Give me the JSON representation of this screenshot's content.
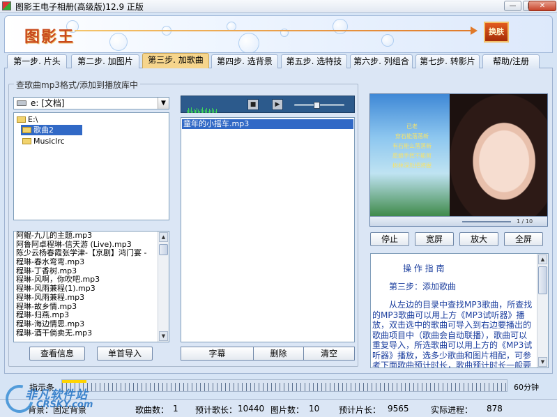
{
  "window": {
    "title": "图影王电子相册(高级版)12.9 正版",
    "minimize": "—",
    "maximize": "□",
    "close": "✕"
  },
  "banner": {
    "logo": "图影王",
    "skin_button": "换肤"
  },
  "tabs": [
    {
      "label": "第一步. 片头"
    },
    {
      "label": "第二步. 加图片"
    },
    {
      "label": "第三步. 加歌曲",
      "active": true
    },
    {
      "label": "第四步. 选背景"
    },
    {
      "label": "第五步. 选特技"
    },
    {
      "label": "第六步. 列组合"
    },
    {
      "label": "第七步. 转影片"
    },
    {
      "label": "帮助/注册"
    }
  ],
  "music_group": {
    "legend": "查歌曲mp3格式/添加到播放库中",
    "drive": "e: [文档]",
    "dirs": [
      {
        "name": "E:\\",
        "selected": false
      },
      {
        "name": "歌曲2",
        "selected": true
      },
      {
        "name": "Musiclrc",
        "selected": false
      }
    ],
    "files": [
      "阿鲲-九儿的主题.mp3",
      "阿鲁阿卓程琳-信天游 (Live).mp3",
      "陈少云杨春霞张学津-【京剧】鸿门宴 -",
      "程琳-春水弯弯.mp3",
      "程琳-丁香树.mp3",
      "程琳-风啊，你吹吧.mp3",
      "程琳-风雨兼程(1).mp3",
      "程琳-风雨兼程.mp3",
      "程琳-故乡情.mp3",
      "程琳-归燕.mp3",
      "程琳-海边情思.mp3",
      "程琳-酒干倘卖无.mp3"
    ],
    "view_info_button": "查看信息",
    "import_button": "单首导入"
  },
  "player": {
    "stop_icon": "stop-icon",
    "play_icon": "play-icon",
    "volume_level": 0.45,
    "playlist": [
      "童年的小摇车.mp3"
    ],
    "subtitle_button": "字幕",
    "delete_button": "删除",
    "clear_button": "清空"
  },
  "preview": {
    "poem_title": "已老",
    "poem_lines": [
      "穿石能落落新",
      "有石能么落落新",
      "愿娘手挥不能剪",
      "树林深处把将握"
    ],
    "page": "1 / 10",
    "stop_button": "停止",
    "wide_button": "宽屏",
    "zoom_button": "放大",
    "fullscreen_button": "全屏"
  },
  "guide": {
    "title": "操 作 指 南",
    "step": "第三步：添加歌曲",
    "body": "从左边的目录中查找MP3歌曲，所查找的MP3歌曲可以用上方《MP3试听器》播放，双击选中的歌曲可导入到右边要播出的歌曲项目中（歌曲会自动联播），歌曲可以重复导入，所选歌曲可以用上方的《MP3试听器》播放，选多少歌曲和图片相配，可参考下面歌曲预计时长，歌曲预计时长一般要大"
  },
  "ruler": {
    "label": "指示条",
    "max": "60分钟",
    "progress": 0.055
  },
  "status": {
    "background_label": "背景：固定背景",
    "song_count_label": "歌曲数：",
    "song_count": "1",
    "song_length_label": "预计歌长：",
    "song_length": "10440",
    "image_count_label": "图片数：",
    "image_count": "10",
    "film_length_label": "预计片长：",
    "film_length": "9565",
    "progress_label": "实际进程：",
    "progress_value": "878"
  },
  "watermark": {
    "text": "非凡软件站",
    "sub": "CRSKY.com"
  }
}
